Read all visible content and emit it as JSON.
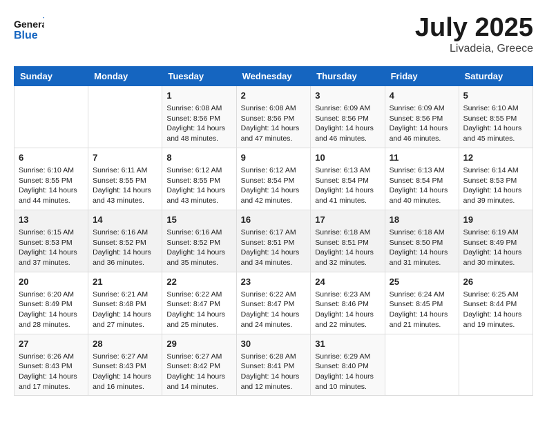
{
  "logo": {
    "general": "General",
    "blue": "Blue"
  },
  "title": "July 2025",
  "location": "Livadeia, Greece",
  "days_header": [
    "Sunday",
    "Monday",
    "Tuesday",
    "Wednesday",
    "Thursday",
    "Friday",
    "Saturday"
  ],
  "weeks": [
    [
      {
        "day": "",
        "sunrise": "",
        "sunset": "",
        "daylight": ""
      },
      {
        "day": "",
        "sunrise": "",
        "sunset": "",
        "daylight": ""
      },
      {
        "day": "1",
        "sunrise": "Sunrise: 6:08 AM",
        "sunset": "Sunset: 8:56 PM",
        "daylight": "Daylight: 14 hours and 48 minutes."
      },
      {
        "day": "2",
        "sunrise": "Sunrise: 6:08 AM",
        "sunset": "Sunset: 8:56 PM",
        "daylight": "Daylight: 14 hours and 47 minutes."
      },
      {
        "day": "3",
        "sunrise": "Sunrise: 6:09 AM",
        "sunset": "Sunset: 8:56 PM",
        "daylight": "Daylight: 14 hours and 46 minutes."
      },
      {
        "day": "4",
        "sunrise": "Sunrise: 6:09 AM",
        "sunset": "Sunset: 8:56 PM",
        "daylight": "Daylight: 14 hours and 46 minutes."
      },
      {
        "day": "5",
        "sunrise": "Sunrise: 6:10 AM",
        "sunset": "Sunset: 8:55 PM",
        "daylight": "Daylight: 14 hours and 45 minutes."
      }
    ],
    [
      {
        "day": "6",
        "sunrise": "Sunrise: 6:10 AM",
        "sunset": "Sunset: 8:55 PM",
        "daylight": "Daylight: 14 hours and 44 minutes."
      },
      {
        "day": "7",
        "sunrise": "Sunrise: 6:11 AM",
        "sunset": "Sunset: 8:55 PM",
        "daylight": "Daylight: 14 hours and 43 minutes."
      },
      {
        "day": "8",
        "sunrise": "Sunrise: 6:12 AM",
        "sunset": "Sunset: 8:55 PM",
        "daylight": "Daylight: 14 hours and 43 minutes."
      },
      {
        "day": "9",
        "sunrise": "Sunrise: 6:12 AM",
        "sunset": "Sunset: 8:54 PM",
        "daylight": "Daylight: 14 hours and 42 minutes."
      },
      {
        "day": "10",
        "sunrise": "Sunrise: 6:13 AM",
        "sunset": "Sunset: 8:54 PM",
        "daylight": "Daylight: 14 hours and 41 minutes."
      },
      {
        "day": "11",
        "sunrise": "Sunrise: 6:13 AM",
        "sunset": "Sunset: 8:54 PM",
        "daylight": "Daylight: 14 hours and 40 minutes."
      },
      {
        "day": "12",
        "sunrise": "Sunrise: 6:14 AM",
        "sunset": "Sunset: 8:53 PM",
        "daylight": "Daylight: 14 hours and 39 minutes."
      }
    ],
    [
      {
        "day": "13",
        "sunrise": "Sunrise: 6:15 AM",
        "sunset": "Sunset: 8:53 PM",
        "daylight": "Daylight: 14 hours and 37 minutes."
      },
      {
        "day": "14",
        "sunrise": "Sunrise: 6:16 AM",
        "sunset": "Sunset: 8:52 PM",
        "daylight": "Daylight: 14 hours and 36 minutes."
      },
      {
        "day": "15",
        "sunrise": "Sunrise: 6:16 AM",
        "sunset": "Sunset: 8:52 PM",
        "daylight": "Daylight: 14 hours and 35 minutes."
      },
      {
        "day": "16",
        "sunrise": "Sunrise: 6:17 AM",
        "sunset": "Sunset: 8:51 PM",
        "daylight": "Daylight: 14 hours and 34 minutes."
      },
      {
        "day": "17",
        "sunrise": "Sunrise: 6:18 AM",
        "sunset": "Sunset: 8:51 PM",
        "daylight": "Daylight: 14 hours and 32 minutes."
      },
      {
        "day": "18",
        "sunrise": "Sunrise: 6:18 AM",
        "sunset": "Sunset: 8:50 PM",
        "daylight": "Daylight: 14 hours and 31 minutes."
      },
      {
        "day": "19",
        "sunrise": "Sunrise: 6:19 AM",
        "sunset": "Sunset: 8:49 PM",
        "daylight": "Daylight: 14 hours and 30 minutes."
      }
    ],
    [
      {
        "day": "20",
        "sunrise": "Sunrise: 6:20 AM",
        "sunset": "Sunset: 8:49 PM",
        "daylight": "Daylight: 14 hours and 28 minutes."
      },
      {
        "day": "21",
        "sunrise": "Sunrise: 6:21 AM",
        "sunset": "Sunset: 8:48 PM",
        "daylight": "Daylight: 14 hours and 27 minutes."
      },
      {
        "day": "22",
        "sunrise": "Sunrise: 6:22 AM",
        "sunset": "Sunset: 8:47 PM",
        "daylight": "Daylight: 14 hours and 25 minutes."
      },
      {
        "day": "23",
        "sunrise": "Sunrise: 6:22 AM",
        "sunset": "Sunset: 8:47 PM",
        "daylight": "Daylight: 14 hours and 24 minutes."
      },
      {
        "day": "24",
        "sunrise": "Sunrise: 6:23 AM",
        "sunset": "Sunset: 8:46 PM",
        "daylight": "Daylight: 14 hours and 22 minutes."
      },
      {
        "day": "25",
        "sunrise": "Sunrise: 6:24 AM",
        "sunset": "Sunset: 8:45 PM",
        "daylight": "Daylight: 14 hours and 21 minutes."
      },
      {
        "day": "26",
        "sunrise": "Sunrise: 6:25 AM",
        "sunset": "Sunset: 8:44 PM",
        "daylight": "Daylight: 14 hours and 19 minutes."
      }
    ],
    [
      {
        "day": "27",
        "sunrise": "Sunrise: 6:26 AM",
        "sunset": "Sunset: 8:43 PM",
        "daylight": "Daylight: 14 hours and 17 minutes."
      },
      {
        "day": "28",
        "sunrise": "Sunrise: 6:27 AM",
        "sunset": "Sunset: 8:43 PM",
        "daylight": "Daylight: 14 hours and 16 minutes."
      },
      {
        "day": "29",
        "sunrise": "Sunrise: 6:27 AM",
        "sunset": "Sunset: 8:42 PM",
        "daylight": "Daylight: 14 hours and 14 minutes."
      },
      {
        "day": "30",
        "sunrise": "Sunrise: 6:28 AM",
        "sunset": "Sunset: 8:41 PM",
        "daylight": "Daylight: 14 hours and 12 minutes."
      },
      {
        "day": "31",
        "sunrise": "Sunrise: 6:29 AM",
        "sunset": "Sunset: 8:40 PM",
        "daylight": "Daylight: 14 hours and 10 minutes."
      },
      {
        "day": "",
        "sunrise": "",
        "sunset": "",
        "daylight": ""
      },
      {
        "day": "",
        "sunrise": "",
        "sunset": "",
        "daylight": ""
      }
    ]
  ]
}
